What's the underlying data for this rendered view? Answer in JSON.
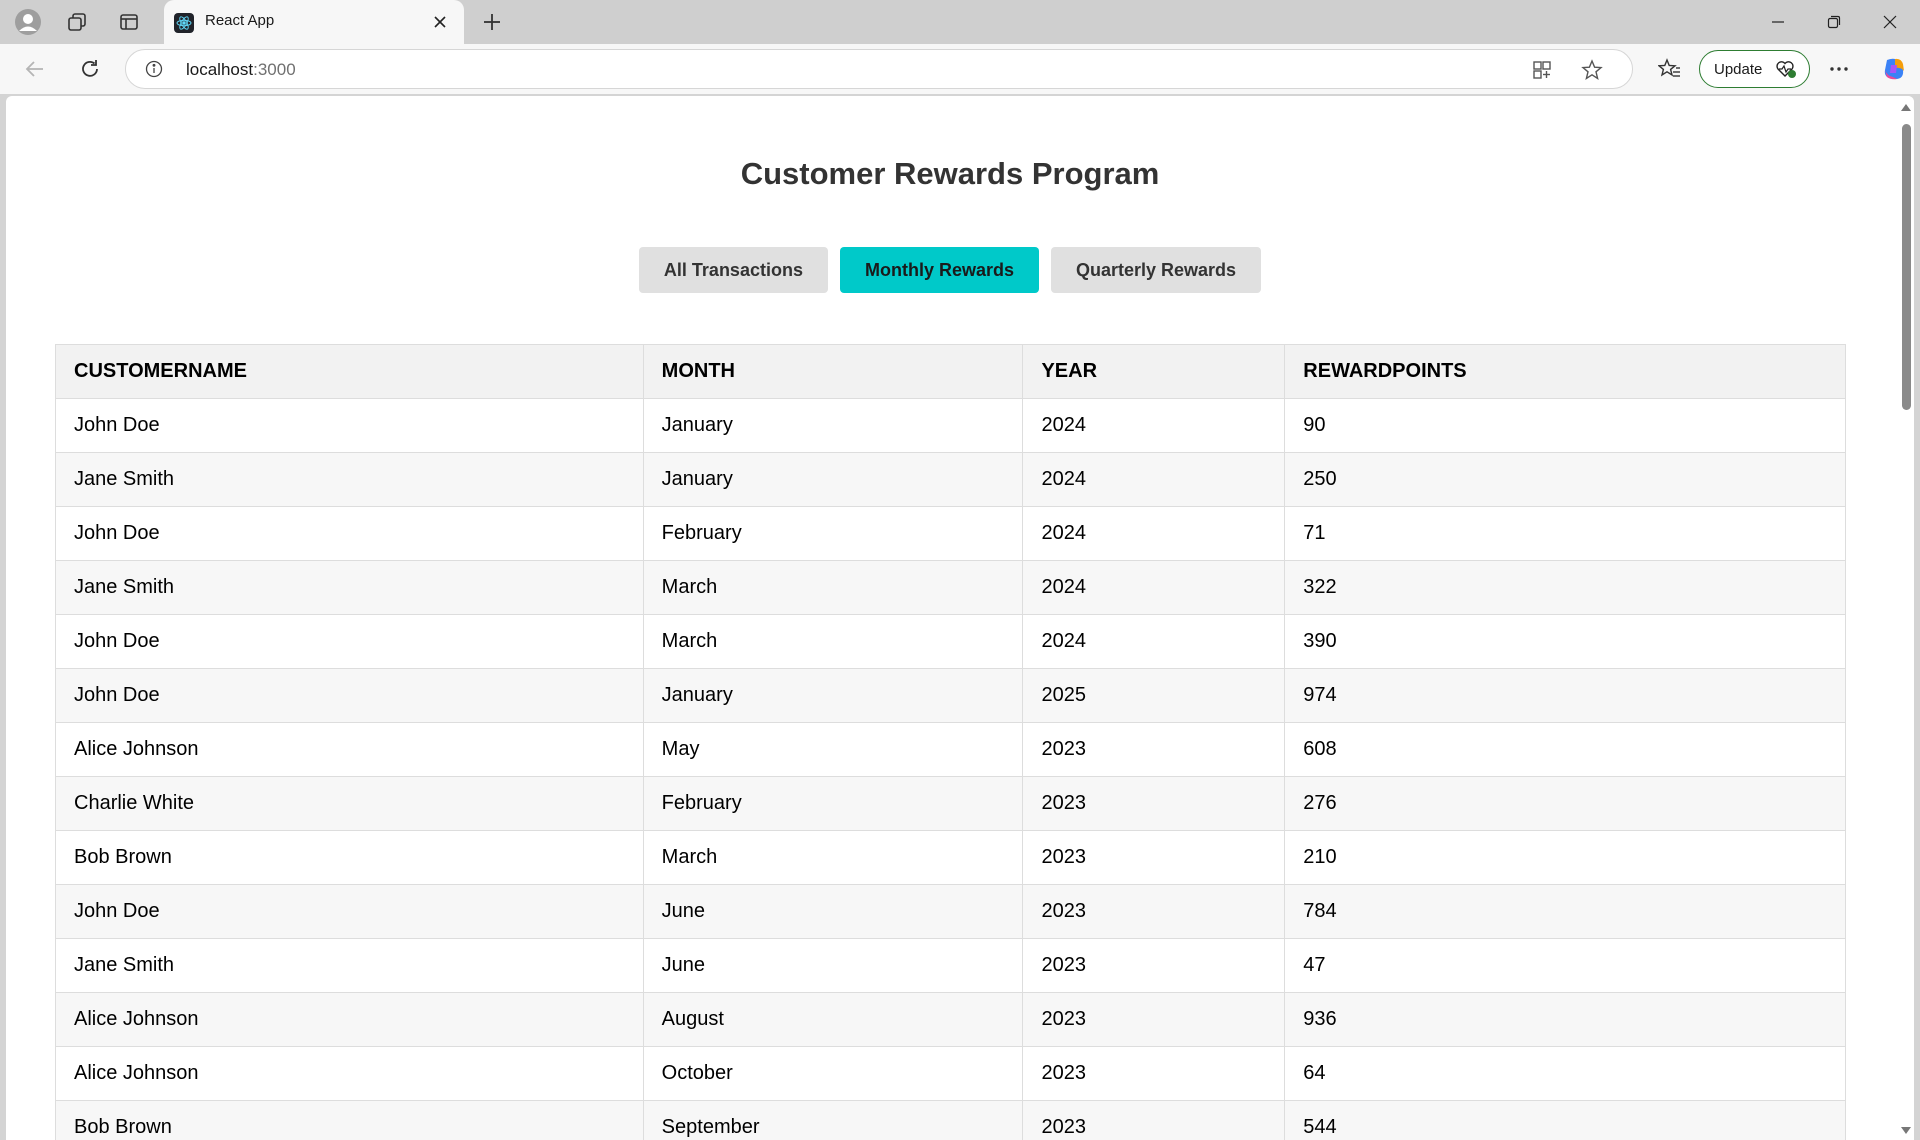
{
  "browser": {
    "tab_title": "React App",
    "url_host": "localhost",
    "url_port": ":3000",
    "update_label": "Update"
  },
  "page": {
    "title": "Customer Rewards Program",
    "buttons": [
      {
        "label": "All Transactions",
        "active": false
      },
      {
        "label": "Monthly Rewards",
        "active": true
      },
      {
        "label": "Quarterly Rewards",
        "active": false
      }
    ],
    "accent_color": "#00c9c9"
  },
  "table": {
    "headers": [
      "customerName",
      "month",
      "year",
      "rewardPoints"
    ],
    "rows": [
      [
        "John Doe",
        "January",
        "2024",
        "90"
      ],
      [
        "Jane Smith",
        "January",
        "2024",
        "250"
      ],
      [
        "John Doe",
        "February",
        "2024",
        "71"
      ],
      [
        "Jane Smith",
        "March",
        "2024",
        "322"
      ],
      [
        "John Doe",
        "March",
        "2024",
        "390"
      ],
      [
        "John Doe",
        "January",
        "2025",
        "974"
      ],
      [
        "Alice Johnson",
        "May",
        "2023",
        "608"
      ],
      [
        "Charlie White",
        "February",
        "2023",
        "276"
      ],
      [
        "Bob Brown",
        "March",
        "2023",
        "210"
      ],
      [
        "John Doe",
        "June",
        "2023",
        "784"
      ],
      [
        "Jane Smith",
        "June",
        "2023",
        "47"
      ],
      [
        "Alice Johnson",
        "August",
        "2023",
        "936"
      ],
      [
        "Alice Johnson",
        "October",
        "2023",
        "64"
      ],
      [
        "Bob Brown",
        "September",
        "2023",
        "544"
      ]
    ]
  }
}
